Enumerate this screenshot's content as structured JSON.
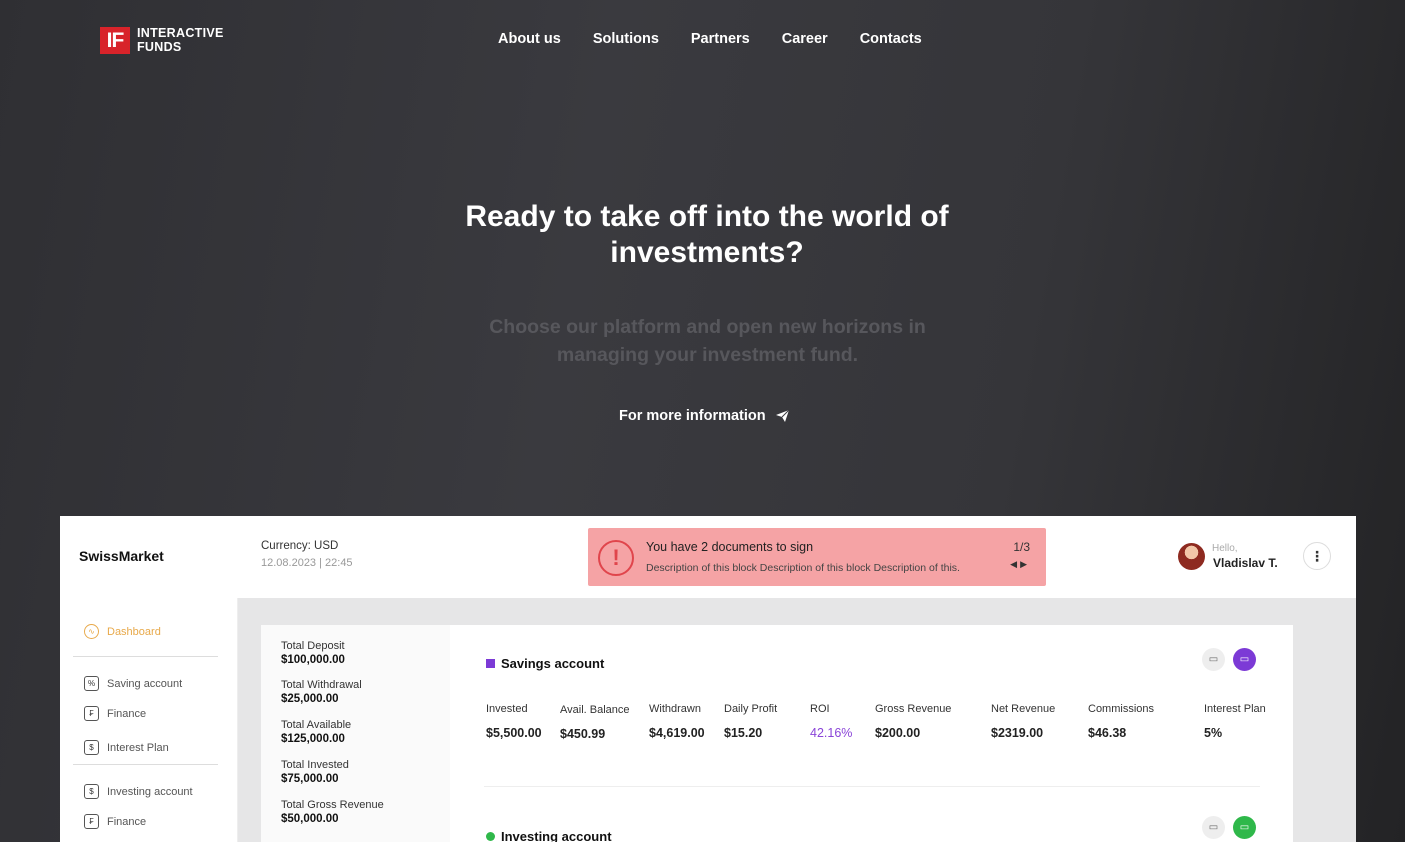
{
  "logo": {
    "mark": "IF",
    "text": "INTERACTIVE\nFUNDS"
  },
  "nav": [
    "About us",
    "Solutions",
    "Partners",
    "Career",
    "Contacts"
  ],
  "hero": {
    "title": "Ready to take off into the world of investments?",
    "subtitle": "Choose our platform and open new horizons in managing your investment fund.",
    "cta": "For more information"
  },
  "dashboard": {
    "brand": "SwissMarket",
    "currency": "Currency: USD",
    "datetime": "12.08.2023 | 22:45",
    "alert": {
      "title": "You have 2 documents to sign",
      "description": "Description of this block Description of this block Description of this.",
      "counter": "1/3"
    },
    "user": {
      "greeting": "Hello,",
      "name": "Vladislav T."
    },
    "sidebar": [
      {
        "label": "Dashboard",
        "icon": "activity-icon"
      },
      {
        "label": "Saving account",
        "icon": "percent-icon"
      },
      {
        "label": "Finance",
        "icon": "finance-icon"
      },
      {
        "label": "Interest Plan",
        "icon": "document-icon"
      },
      {
        "label": "Investing account",
        "icon": "dollar-icon"
      },
      {
        "label": "Finance",
        "icon": "finance-icon"
      }
    ],
    "totals": [
      {
        "label": "Total Deposit",
        "value": "$100,000.00"
      },
      {
        "label": "Total Withdrawal",
        "value": "$25,000.00"
      },
      {
        "label": "Total Available",
        "value": "$125,000.00"
      },
      {
        "label": "Total Invested",
        "value": "$75,000.00"
      },
      {
        "label": "Total Gross Revenue",
        "value": "$50,000.00"
      }
    ],
    "savings": {
      "title": "Savings account",
      "stats": [
        {
          "label": "Invested",
          "value": "$5,500.00"
        },
        {
          "label": "Avail. Balance",
          "value": "$450.99"
        },
        {
          "label": "Withdrawn",
          "value": "$4,619.00"
        },
        {
          "label": "Daily Profit",
          "value": "$15.20"
        },
        {
          "label": "ROI",
          "value": "42.16%"
        },
        {
          "label": "Gross Revenue",
          "value": "$200.00"
        },
        {
          "label": "Net Revenue",
          "value": "$2319.00"
        },
        {
          "label": "Commissions",
          "value": "$46.38"
        },
        {
          "label": "Interest Plan",
          "value": "5%"
        }
      ]
    },
    "investing": {
      "title": "Investing account"
    },
    "colors": {
      "accent_orange": "#e8a94a",
      "purple": "#7c3ad6",
      "green": "#2fb84a",
      "alert_bg": "#f5a3a5",
      "logo_red": "#d8232a"
    }
  }
}
